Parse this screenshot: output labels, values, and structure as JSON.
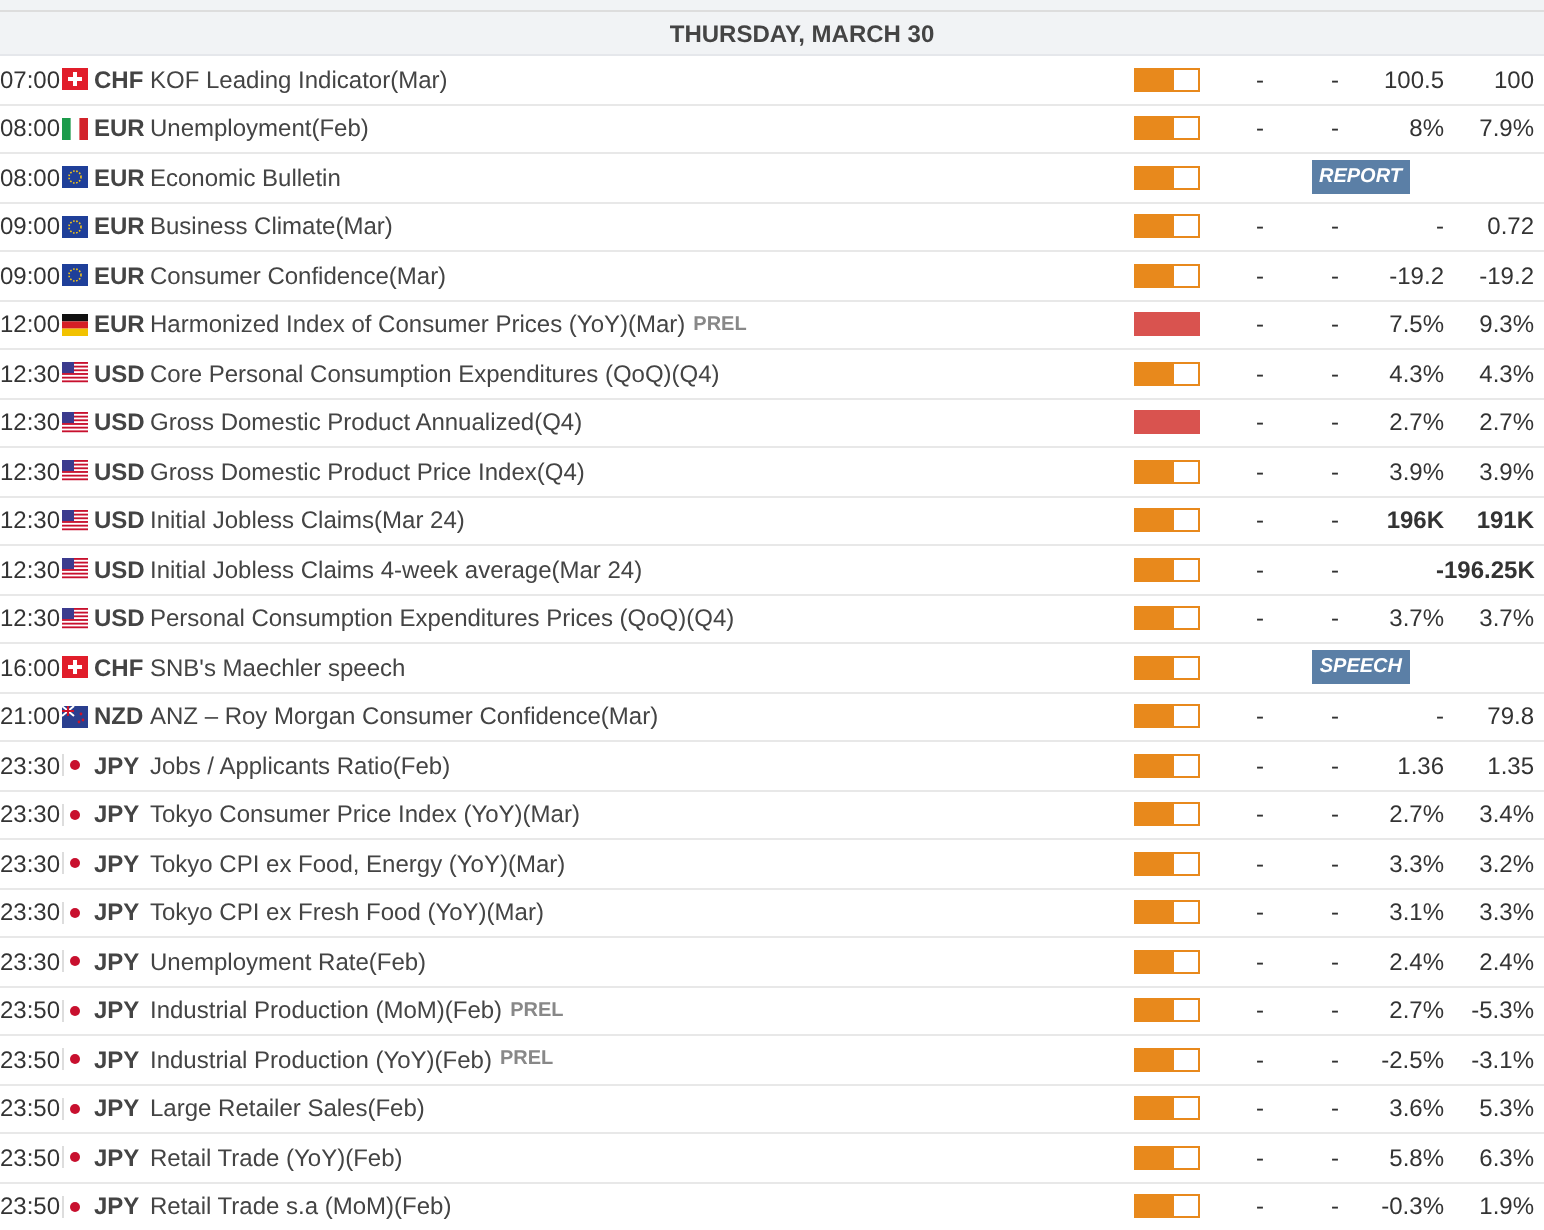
{
  "date_header": "THURSDAY, MARCH 30",
  "events": [
    {
      "time": "07:00",
      "kind": "ch",
      "currency": "CHF",
      "event": "KOF Leading Indicator(Mar)",
      "level": 0.6,
      "actual": "-",
      "deviation": "-",
      "consensus": "100.5",
      "previous": "100",
      "bold_values": false
    },
    {
      "time": "08:00",
      "kind": "it",
      "currency": "EUR",
      "event": "Unemployment(Feb)",
      "level": 0.6,
      "actual": "-",
      "deviation": "-",
      "consensus": "8%",
      "previous": "7.9%",
      "bold_values": false
    },
    {
      "time": "08:00",
      "kind": "eu",
      "currency": "EUR",
      "event": "Economic Bulletin",
      "level": 0.6,
      "badge": "REPORT"
    },
    {
      "time": "09:00",
      "kind": "eu",
      "currency": "EUR",
      "event": "Business Climate(Mar)",
      "level": 0.6,
      "actual": "-",
      "deviation": "-",
      "consensus": "-",
      "previous": "0.72",
      "bold_values": false
    },
    {
      "time": "09:00",
      "kind": "eu",
      "currency": "EUR",
      "event": "Consumer Confidence(Mar)",
      "level": 0.6,
      "actual": "-",
      "deviation": "-",
      "consensus": "-19.2",
      "previous": "-19.2",
      "bold_values": false
    },
    {
      "time": "12:00",
      "kind": "de",
      "currency": "EUR",
      "event": "Harmonized Index of Consumer Prices (YoY)(Mar)",
      "tag": "PREL",
      "level": 1,
      "actual": "-",
      "deviation": "-",
      "consensus": "7.5%",
      "previous": "9.3%",
      "bold_values": false
    },
    {
      "time": "12:30",
      "kind": "us",
      "currency": "USD",
      "event": "Core Personal Consumption Expenditures (QoQ)(Q4)",
      "level": 0.6,
      "actual": "-",
      "deviation": "-",
      "consensus": "4.3%",
      "previous": "4.3%",
      "bold_values": false
    },
    {
      "time": "12:30",
      "kind": "us",
      "currency": "USD",
      "event": "Gross Domestic Product Annualized(Q4)",
      "level": 1,
      "actual": "-",
      "deviation": "-",
      "consensus": "2.7%",
      "previous": "2.7%",
      "bold_values": false
    },
    {
      "time": "12:30",
      "kind": "us",
      "currency": "USD",
      "event": "Gross Domestic Product Price Index(Q4)",
      "level": 0.6,
      "actual": "-",
      "deviation": "-",
      "consensus": "3.9%",
      "previous": "3.9%",
      "bold_values": false
    },
    {
      "time": "12:30",
      "kind": "us",
      "currency": "USD",
      "event": "Initial Jobless Claims(Mar 24)",
      "level": 0.6,
      "actual": "-",
      "deviation": "-",
      "consensus": "196K",
      "previous": "191K",
      "bold_values": true
    },
    {
      "time": "12:30",
      "kind": "us",
      "currency": "USD",
      "event": "Initial Jobless Claims 4-week average(Mar 24)",
      "level": 0.6,
      "actual": "-",
      "deviation": "-",
      "consensus": "-",
      "previous": "196.25K",
      "bold_values": true
    },
    {
      "time": "12:30",
      "kind": "us",
      "currency": "USD",
      "event": "Personal Consumption Expenditures Prices (QoQ)(Q4)",
      "level": 0.6,
      "actual": "-",
      "deviation": "-",
      "consensus": "3.7%",
      "previous": "3.7%",
      "bold_values": false
    },
    {
      "time": "16:00",
      "kind": "ch",
      "currency": "CHF",
      "event": "SNB's Maechler speech",
      "level": 0.6,
      "badge": "SPEECH"
    },
    {
      "time": "21:00",
      "kind": "nz",
      "currency": "NZD",
      "event": "ANZ – Roy Morgan Consumer Confidence(Mar)",
      "level": 0.6,
      "actual": "-",
      "deviation": "-",
      "consensus": "-",
      "previous": "79.8",
      "bold_values": false
    },
    {
      "time": "23:30",
      "kind": "jp",
      "currency": "JPY",
      "event": "Jobs / Applicants Ratio(Feb)",
      "level": 0.6,
      "actual": "-",
      "deviation": "-",
      "consensus": "1.36",
      "previous": "1.35",
      "bold_values": false
    },
    {
      "time": "23:30",
      "kind": "jp",
      "currency": "JPY",
      "event": "Tokyo Consumer Price Index (YoY)(Mar)",
      "level": 0.6,
      "actual": "-",
      "deviation": "-",
      "consensus": "2.7%",
      "previous": "3.4%",
      "bold_values": false
    },
    {
      "time": "23:30",
      "kind": "jp",
      "currency": "JPY",
      "event": "Tokyo CPI ex Food, Energy (YoY)(Mar)",
      "level": 0.6,
      "actual": "-",
      "deviation": "-",
      "consensus": "3.3%",
      "previous": "3.2%",
      "bold_values": false
    },
    {
      "time": "23:30",
      "kind": "jp",
      "currency": "JPY",
      "event": "Tokyo CPI ex Fresh Food (YoY)(Mar)",
      "level": 0.6,
      "actual": "-",
      "deviation": "-",
      "consensus": "3.1%",
      "previous": "3.3%",
      "bold_values": false
    },
    {
      "time": "23:30",
      "kind": "jp",
      "currency": "JPY",
      "event": "Unemployment Rate(Feb)",
      "level": 0.6,
      "actual": "-",
      "deviation": "-",
      "consensus": "2.4%",
      "previous": "2.4%",
      "bold_values": false
    },
    {
      "time": "23:50",
      "kind": "jp",
      "currency": "JPY",
      "event": "Industrial Production (MoM)(Feb)",
      "tag": "PREL",
      "level": 0.6,
      "actual": "-",
      "deviation": "-",
      "consensus": "2.7%",
      "previous": "-5.3%",
      "bold_values": false
    },
    {
      "time": "23:50",
      "kind": "jp",
      "currency": "JPY",
      "event": "Industrial Production (YoY)(Feb)",
      "tag": "PREL",
      "level": 0.6,
      "actual": "-",
      "deviation": "-",
      "consensus": "-2.5%",
      "previous": "-3.1%",
      "bold_values": false
    },
    {
      "time": "23:50",
      "kind": "jp",
      "currency": "JPY",
      "event": "Large Retailer Sales(Feb)",
      "level": 0.6,
      "actual": "-",
      "deviation": "-",
      "consensus": "3.6%",
      "previous": "5.3%",
      "bold_values": false
    },
    {
      "time": "23:50",
      "kind": "jp",
      "currency": "JPY",
      "event": "Retail Trade (YoY)(Feb)",
      "level": 0.6,
      "actual": "-",
      "deviation": "-",
      "consensus": "5.8%",
      "previous": "6.3%",
      "bold_values": false
    },
    {
      "time": "23:50",
      "kind": "jp",
      "currency": "JPY",
      "event": "Retail Trade s.a (MoM)(Feb)",
      "level": 0.6,
      "actual": "-",
      "deviation": "-",
      "consensus": "-0.3%",
      "previous": "1.9%",
      "bold_values": false
    }
  ]
}
